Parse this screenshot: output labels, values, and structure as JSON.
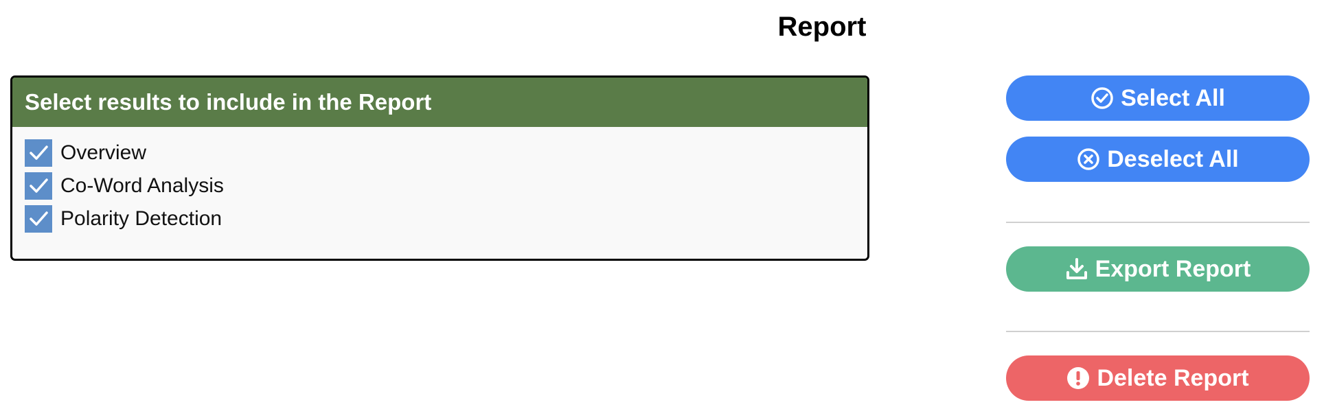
{
  "page": {
    "title": "Report"
  },
  "panel": {
    "header": "Select results to include in the Report",
    "options": [
      {
        "label": "Overview",
        "checked": true
      },
      {
        "label": "Co-Word Analysis",
        "checked": true
      },
      {
        "label": "Polarity Detection",
        "checked": true
      }
    ]
  },
  "actions": {
    "select_all": {
      "label": "Select All",
      "icon": "check-circle-icon",
      "color": "#4285f4"
    },
    "deselect_all": {
      "label": "Deselect All",
      "icon": "x-circle-icon",
      "color": "#4285f4"
    },
    "export_report": {
      "label": "Export Report",
      "icon": "download-icon",
      "color": "#5cb78f"
    },
    "delete_report": {
      "label": "Delete Report",
      "icon": "exclamation-circle-icon",
      "color": "#ed6567"
    }
  },
  "colors": {
    "panel_header": "#5a7c48",
    "checkbox": "#5d8ec9"
  }
}
